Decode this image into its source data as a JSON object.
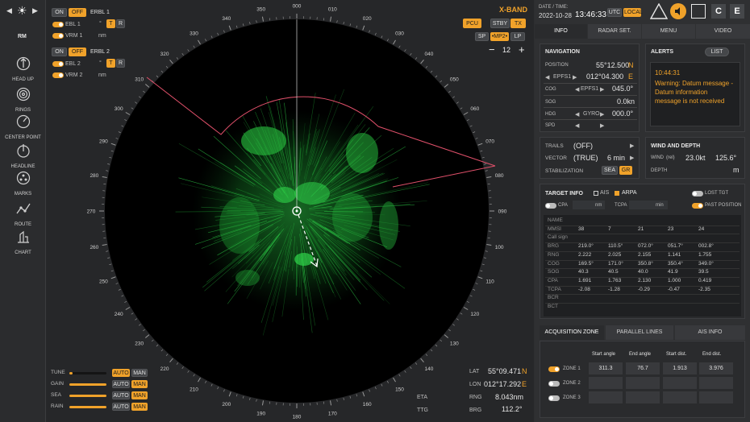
{
  "colors": {
    "accent": "#f0a22a",
    "radar_echo": "#22c33a",
    "heading_line": "#ffffff",
    "warning": "#f0a22a",
    "guard_zone": "#e0506a"
  },
  "left_toolbar": {
    "range_mode": "RM",
    "items": [
      {
        "label": "HEAD UP",
        "icon": "compass-arrow-icon"
      },
      {
        "label": "RINGS",
        "icon": "rings-icon"
      },
      {
        "label": "CENTER POINT",
        "icon": "center-point-icon"
      },
      {
        "label": "HEADLINE",
        "icon": "headline-icon"
      },
      {
        "label": "MARKS",
        "icon": "marks-icon"
      },
      {
        "label": "ROUTE",
        "icon": "route-icon"
      },
      {
        "label": "CHART",
        "icon": "chart-icon"
      }
    ]
  },
  "ebl_vrm": {
    "group1": {
      "on": "ON",
      "off": "OFF",
      "title": "ERBL 1",
      "ebl": "EBL 1",
      "vrm": "VRM 1",
      "deg_unit": "°",
      "t": "T",
      "r": "R",
      "nm_unit": "nm"
    },
    "group2": {
      "on": "ON",
      "off": "OFF",
      "title": "ERBL 2",
      "ebl": "EBL 2",
      "vrm": "VRM 2",
      "deg_unit": "°",
      "t": "T",
      "r": "R",
      "nm_unit": "nm"
    }
  },
  "radar_controls": {
    "band": "X-BAND",
    "pcu": "PCU",
    "stby": "STBY",
    "tx": "TX",
    "pulses": [
      "SP",
      "•MP2•",
      "LP"
    ],
    "range": "12",
    "minus": "−",
    "plus": "+"
  },
  "bearing_labels": [
    "000",
    "010",
    "020",
    "030",
    "040",
    "050",
    "060",
    "070",
    "080",
    "090",
    "100",
    "110",
    "120",
    "130",
    "140",
    "150",
    "160",
    "170",
    "180",
    "190",
    "200",
    "210",
    "220",
    "230",
    "240",
    "250",
    "260",
    "270",
    "280",
    "290",
    "300",
    "310",
    "320",
    "330",
    "340",
    "350"
  ],
  "gain_controls": [
    {
      "label": "TUNE",
      "auto": "AUTO",
      "man": "MAN",
      "level": 0.08,
      "mode": "AUTO"
    },
    {
      "label": "GAIN",
      "auto": "AUTO",
      "man": "MAN",
      "level": 1.0,
      "mode": "MAN"
    },
    {
      "label": "SEA",
      "auto": "AUTO",
      "man": "MAN",
      "level": 1.0,
      "mode": "MAN"
    },
    {
      "label": "RAIN",
      "auto": "AUTO",
      "man": "MAN",
      "level": 1.0,
      "mode": "MAN"
    }
  ],
  "cursor": {
    "lat_label": "LAT",
    "lat": "55°09.471",
    "lat_hemi": "N",
    "lon_label": "LON",
    "lon": "012°17.292",
    "lon_hemi": "E",
    "rng_label": "RNG",
    "rng": "8.043nm",
    "brg_label": "BRG",
    "brg": "112.2°",
    "eta_label": "ETA",
    "ttg_label": "TTG"
  },
  "header": {
    "date_label": "DATE / TIME:",
    "date": "2022-10-28",
    "time": "13:46:33",
    "utc": "UTC",
    "local": "LOCAL",
    "c": "C",
    "e": "E"
  },
  "tabs": [
    "INFO",
    "RADAR SET.",
    "MENU",
    "VIDEO"
  ],
  "navigation": {
    "title": "NAVIGATION",
    "position_label": "POSITION",
    "lat": "55°12.500",
    "lat_hemi": "N",
    "epfs": "EPFS1",
    "lon": "012°04.300",
    "lon_hemi": "E",
    "cog_label": "COG",
    "cog_src": "EPFS1",
    "cog": "045.0°",
    "sog_label": "SOG",
    "sog": "0.0kn",
    "hdg_label": "HDG",
    "hdg_src": "GYRO",
    "hdg": "000.0°",
    "spd_label": "SPD"
  },
  "alerts": {
    "title": "ALERTS",
    "list": "LIST",
    "time": "10:44:31",
    "message": "Warning: Datum message - Datum information message is not received"
  },
  "trails": {
    "trails_label": "TRAILS",
    "trails": "(OFF)",
    "vector_label": "VECTOR",
    "vector": "(TRUE)",
    "vector_time": "6 min",
    "stab_label": "STABILIZATION",
    "sea": "SEA",
    "gr": "GR"
  },
  "wind": {
    "title": "WIND AND DEPTH",
    "wind_label": "WIND",
    "rel": "(rel)",
    "speed": "23.0kt",
    "dir": "125.6°",
    "depth_label": "DEPTH",
    "depth_unit": "m"
  },
  "target_info": {
    "title": "TARGET INFO",
    "ais": "AIS",
    "arpa": "ARPA",
    "lost": "LOST TGT",
    "past": "PAST POSITION",
    "cpa": "CPA",
    "nm": "nm",
    "tcpa": "TCPA",
    "min": "min",
    "row_labels": [
      "NAME",
      "MMSI",
      "Call sign",
      "BRG",
      "RNG",
      "COG",
      "SOG",
      "CPA",
      "TCPA",
      "BCR",
      "BCT"
    ],
    "columns": [
      {
        "MMSI": "38",
        "BRG": "219.0°",
        "RNG": "2.222",
        "COG": "169.5°",
        "SOG": "40.3",
        "CPA": "1.691",
        "TCPA": "-2.08"
      },
      {
        "MMSI": "7",
        "BRG": "110.5°",
        "RNG": "2.025",
        "COG": "171.0°",
        "SOG": "40.5",
        "CPA": "1.763",
        "TCPA": "-1.28"
      },
      {
        "MMSI": "21",
        "BRG": "072.0°",
        "RNG": "2.155",
        "COG": "350.8°",
        "SOG": "40.0",
        "CPA": "2.130",
        "TCPA": "-0.29"
      },
      {
        "MMSI": "23",
        "BRG": "051.7°",
        "RNG": "1.141",
        "COG": "350.4°",
        "SOG": "41.9",
        "CPA": "1.000",
        "TCPA": "-0.47"
      },
      {
        "MMSI": "24",
        "BRG": "002.8°",
        "RNG": "1.755",
        "COG": "349.0°",
        "SOG": "39.5",
        "CPA": "0.419",
        "TCPA": "-2.35"
      }
    ]
  },
  "bottom_tabs": [
    "ACQUISITION ZONE",
    "PARALLEL LINES",
    "AIS INFO"
  ],
  "zones": {
    "headers": [
      "Start angle",
      "End angle",
      "Start dist.",
      "End dist."
    ],
    "rows": [
      {
        "label": "ZONE 1",
        "on": true,
        "values": [
          "311.3",
          "76.7",
          "1.913",
          "3.976"
        ]
      },
      {
        "label": "ZONE 2",
        "on": false,
        "values": [
          "",
          "",
          "",
          ""
        ]
      },
      {
        "label": "ZONE 3",
        "on": false,
        "values": [
          "",
          "",
          "",
          ""
        ]
      }
    ]
  }
}
